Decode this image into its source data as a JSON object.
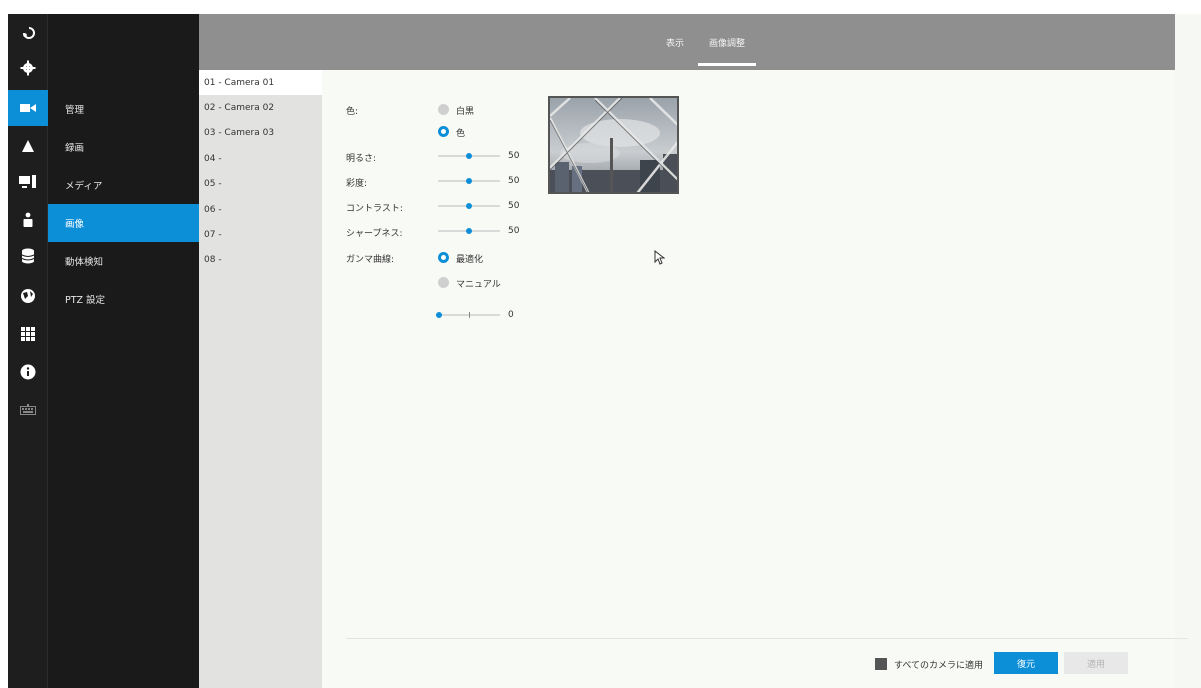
{
  "header": {
    "tabs": [
      {
        "label": "表示"
      },
      {
        "label": "画像調整"
      }
    ]
  },
  "rail": {
    "items": [
      {
        "icon": "logout-icon"
      },
      {
        "icon": "gear-icon"
      },
      {
        "icon": "camera-icon"
      },
      {
        "icon": "alarm-icon"
      },
      {
        "icon": "monitor-icon"
      },
      {
        "icon": "user-icon"
      },
      {
        "icon": "database-icon"
      },
      {
        "icon": "globe-icon"
      },
      {
        "icon": "grid-icon"
      },
      {
        "icon": "info-icon"
      },
      {
        "icon": "keyboard-icon"
      }
    ]
  },
  "menu": {
    "items": [
      {
        "label": "管理"
      },
      {
        "label": "録画"
      },
      {
        "label": "メディア"
      },
      {
        "label": "画像"
      },
      {
        "label": "動体検知"
      },
      {
        "label": "PTZ 設定"
      }
    ]
  },
  "cameras": [
    {
      "label": "01 - Camera 01"
    },
    {
      "label": "02 - Camera 02"
    },
    {
      "label": "03 - Camera 03"
    },
    {
      "label": "04 -"
    },
    {
      "label": "05 -"
    },
    {
      "label": "06 -"
    },
    {
      "label": "07 -"
    },
    {
      "label": "08 -"
    }
  ],
  "settings": {
    "color_label": "色:",
    "color_options": {
      "bw": "白黒",
      "color": "色"
    },
    "brightness_label": "明るさ:",
    "brightness": 50,
    "saturation_label": "彩度:",
    "saturation": 50,
    "contrast_label": "コントラスト:",
    "contrast": 50,
    "sharpness_label": "シャープネス:",
    "sharpness": 50,
    "gamma_label": "ガンマ曲線:",
    "gamma_options": {
      "optimized": "最適化",
      "manual": "マニュアル"
    },
    "gamma_value": 0
  },
  "footer": {
    "apply_all_label": "すべてのカメラに適用",
    "restore_label": "復元",
    "apply_label": "適用"
  },
  "colors": {
    "accent": "#0d8fd8",
    "rail_bg": "#1e1e1e",
    "header_bg": "#8f8f8f"
  }
}
